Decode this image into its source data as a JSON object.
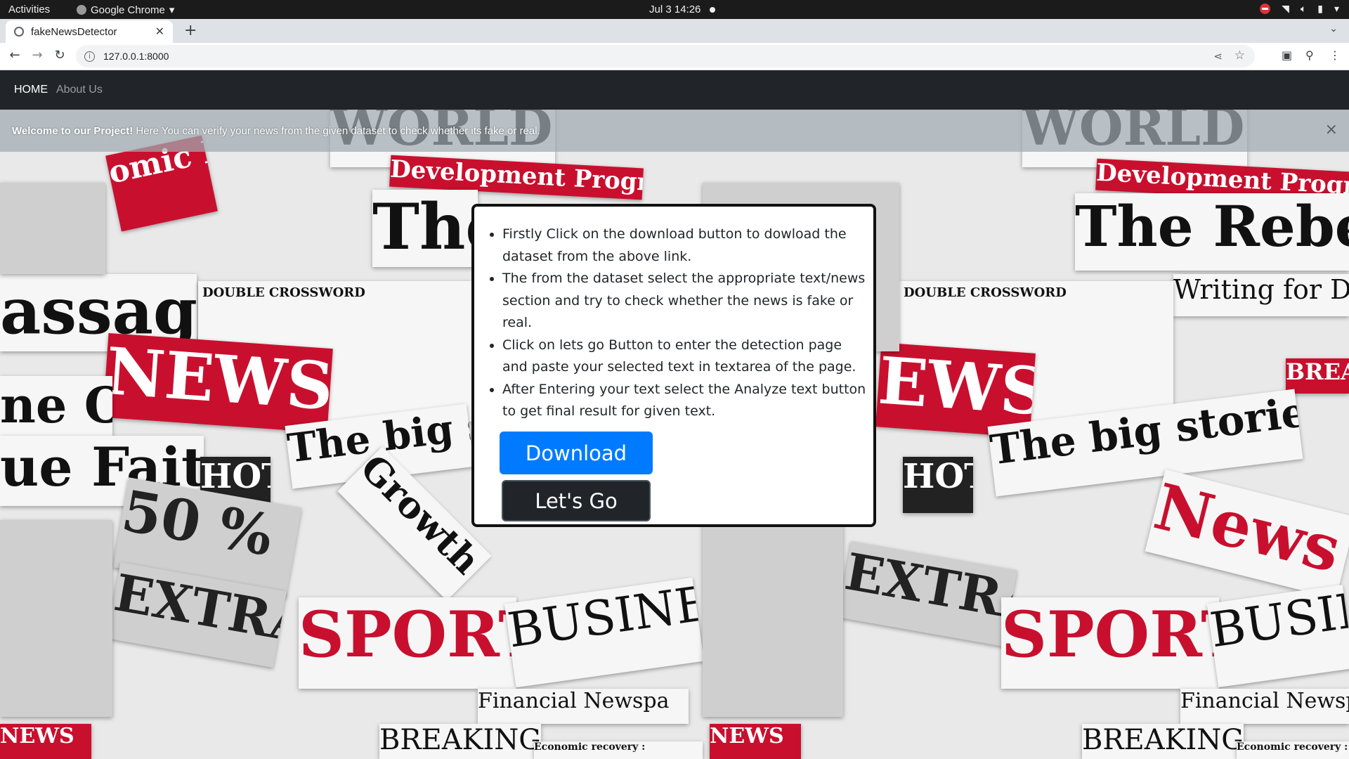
{
  "system_bar": {
    "activities": "Activities",
    "app_name": "Google Chrome",
    "datetime": "Jul 3  14:26"
  },
  "browser": {
    "tab_title": "fakeNewsDetector",
    "url": "127.0.0.1:8000",
    "icons": [
      "back-arrow-icon",
      "forward-arrow-icon",
      "reload-icon",
      "info-icon",
      "share-icon",
      "star-icon",
      "side-panel-icon",
      "extension-icon",
      "kebab-menu-icon"
    ]
  },
  "navbar": {
    "home": "HOME",
    "about": "About Us"
  },
  "alert": {
    "bold": "Welcome to our Project!",
    "text": " Here You can verify your news from the given dataset to check whether its fake or real.",
    "close": "×"
  },
  "instructions": [
    "Firstly Click on the download button to dowload the dataset from the above link.",
    "The from the dataset select the appropriate text/news section and try to check whether the news is fake or real.",
    "Click on lets go Button to enter the detection page and paste your selected text in textarea of the page.",
    "After Entering your text select the Analyze text button to get final result for given text."
  ],
  "buttons": {
    "download": "Download",
    "lets_go": "Let's Go"
  },
  "background_texts": {
    "t1": "WORLD",
    "t2": "Development Programme",
    "t3": "The",
    "t4": "NEWS",
    "t5": "DOUBLE CROSSWORD",
    "t6": "The big stor",
    "t7": "HOT",
    "t8": "SPORTS",
    "t9": "BUSINES",
    "t10": "Financial Newspa",
    "t11": "BREAKING",
    "t12": "ue Faith",
    "t13": "assage",
    "t14": "Growth",
    "t15": "NEWS",
    "t16": "Economic recovery :",
    "t17": "WORLD",
    "t18": "Development Programme",
    "t19": "The Rebel",
    "t20": "EWS",
    "t21": "The big stories of th",
    "t22": "HOT",
    "t23": "SPORTS",
    "t24": "BUSIN",
    "t25": "Financial Newspa",
    "t26": "BREAKING",
    "t27": "News",
    "t28": "50 %",
    "t29": "EXTRA",
    "t30": "Writing for Der",
    "t31": "Economic recovery :",
    "t32": "NEWS",
    "t33": "BREA",
    "t34": "ne Or",
    "t35": "omic Reco"
  }
}
